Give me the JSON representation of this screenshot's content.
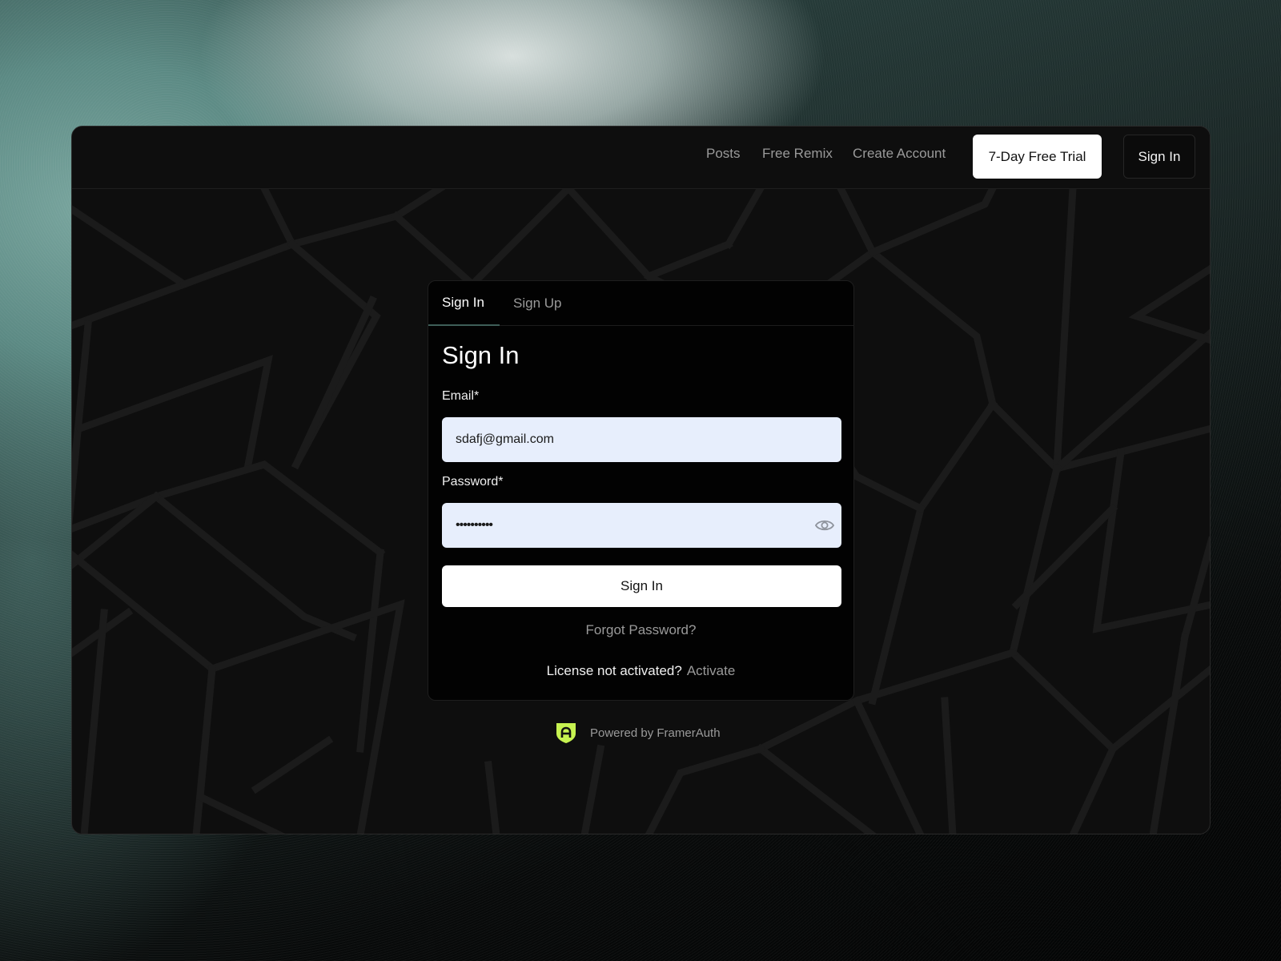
{
  "nav": {
    "links": [
      "Posts",
      "Free Remix",
      "Create Account"
    ],
    "trial_label": "7-Day Free Trial",
    "signin_label": "Sign In"
  },
  "card": {
    "tabs": [
      "Sign In",
      "Sign Up"
    ],
    "active_tab": "Sign In",
    "heading": "Sign In",
    "email": {
      "label": "Email*",
      "value": "sdafj@gmail.com"
    },
    "password": {
      "label": "Password*",
      "masked_value": "••••••••••",
      "toggle_icon": "eye-icon"
    },
    "submit_label": "Sign In",
    "forgot_label": "Forgot Password?",
    "license_text": "License not activated?",
    "activate_label": "Activate"
  },
  "footer": {
    "powered_by": "Powered by FramerAuth",
    "logo_icon": "framerauth-shield-icon",
    "logo_color": "#c6f250"
  },
  "colors": {
    "field_bg": "#e7eefc",
    "card_bg": "#020202",
    "window_bg": "#0e0e0e",
    "accent_tab_underline": "#3e5e58"
  }
}
